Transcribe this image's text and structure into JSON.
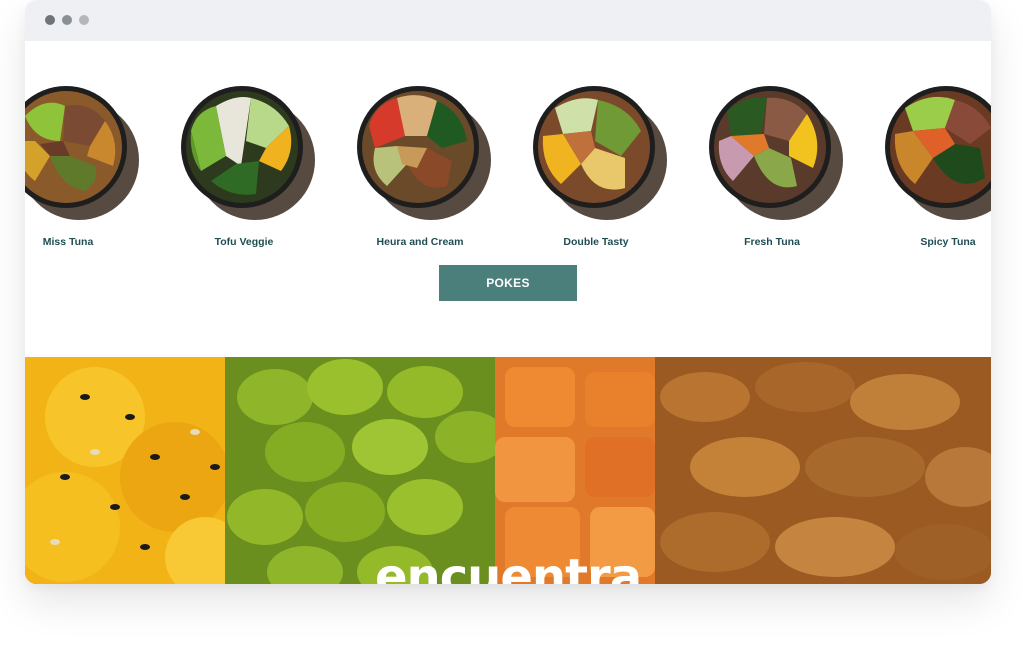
{
  "products": [
    {
      "name": "Miss Tuna",
      "image": "miss-tuna-bowl"
    },
    {
      "name": "Tofu Veggie",
      "image": "tofu-veggie-bowl"
    },
    {
      "name": "Heura and Cream",
      "image": "heura-and-cream-bowl"
    },
    {
      "name": "Double Tasty",
      "image": "double-tasty-bowl"
    },
    {
      "name": "Fresh Tuna",
      "image": "fresh-tuna-bowl"
    },
    {
      "name": "Spicy Tuna",
      "image": "spicy-tuna-bowl"
    }
  ],
  "cta": {
    "label": "POKES"
  },
  "hero": {
    "heading": "encuentra"
  },
  "colors": {
    "accent": "#4b7f7c",
    "product_name": "#1f4d52",
    "titlebar": "#eef0f3"
  }
}
